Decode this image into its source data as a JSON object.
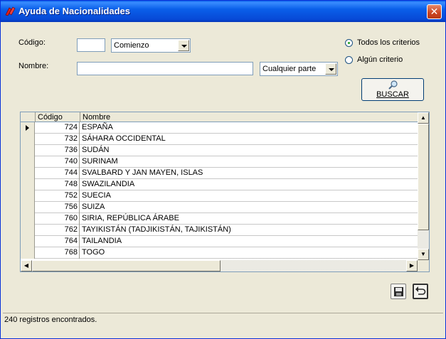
{
  "window": {
    "title": "Ayuda de Nacionalidades",
    "close_symbol": "✕"
  },
  "form": {
    "codigo_label": "Código:",
    "codigo_value": "",
    "codigo_match": "Comienzo",
    "nombre_label": "Nombre:",
    "nombre_value": "",
    "nombre_match": "Cualquier parte",
    "criteria": [
      {
        "label": "Todos los criterios",
        "selected": true
      },
      {
        "label": "Algún criterio",
        "selected": false
      }
    ],
    "search_button": "BUSCAR"
  },
  "grid": {
    "columns": [
      "Código",
      "Nombre"
    ],
    "rows": [
      {
        "code": "724",
        "name": "ESPAÑA"
      },
      {
        "code": "732",
        "name": "SÁHARA OCCIDENTAL"
      },
      {
        "code": "736",
        "name": "SUDÁN"
      },
      {
        "code": "740",
        "name": "SURINAM"
      },
      {
        "code": "744",
        "name": "SVALBARD Y JAN MAYEN, ISLAS"
      },
      {
        "code": "748",
        "name": "SWAZILANDIA"
      },
      {
        "code": "752",
        "name": "SUECIA"
      },
      {
        "code": "756",
        "name": "SUIZA"
      },
      {
        "code": "760",
        "name": "SIRIA, REPÚBLICA ÁRABE"
      },
      {
        "code": "762",
        "name": "TAYIKISTÁN (TADJIKISTÁN, TAJIKISTÁN)"
      },
      {
        "code": "764",
        "name": "TAILANDIA"
      },
      {
        "code": "768",
        "name": "TOGO"
      }
    ],
    "current_row_index": 0
  },
  "actions": {
    "save_icon": "save-icon",
    "undo_icon": "undo-icon"
  },
  "status": {
    "text": "240 registros encontrados."
  }
}
